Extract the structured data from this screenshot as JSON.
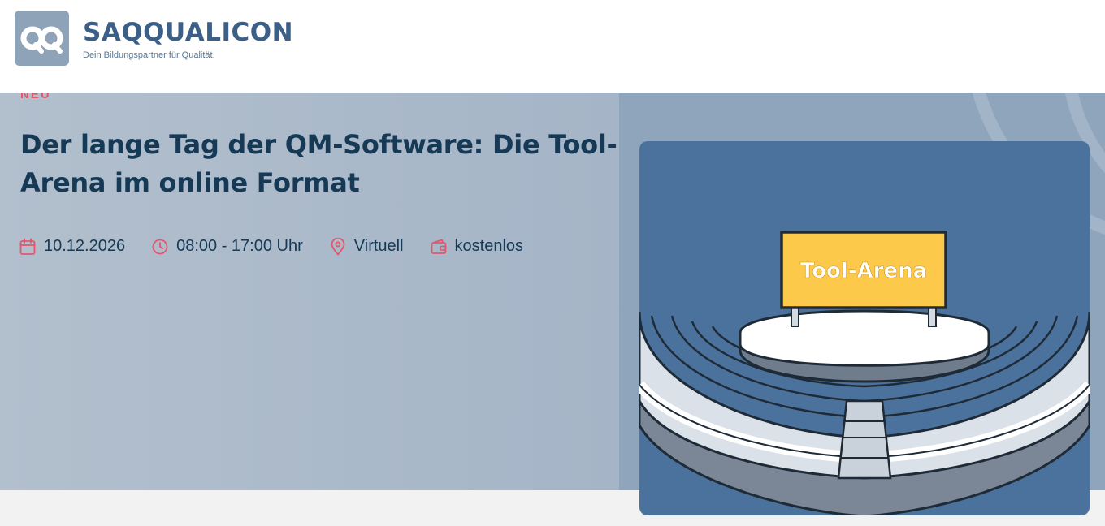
{
  "header": {
    "logo_mark": "QQ",
    "brand": "SAQQUALICON",
    "tagline": "Dein Bildungspartner für Qualität."
  },
  "hero": {
    "category_tag": "NEU",
    "title": "Der lange Tag der QM-Software: Die Tool-Arena im online Format",
    "meta": {
      "date": "10.12.2026",
      "time": "08:00 - 17:00 Uhr",
      "location": "Virtuell",
      "price": "kostenlos"
    },
    "image": {
      "sign_text": "Tool-Arena"
    }
  },
  "colors": {
    "brand_blue": "#3b5f86",
    "title_navy": "#163a56",
    "accent_red": "#e0586c",
    "sign_yellow": "#fcc94a",
    "image_bg": "#4a729c"
  },
  "icons": [
    "calendar-icon",
    "clock-icon",
    "location-pin-icon",
    "wallet-icon"
  ]
}
